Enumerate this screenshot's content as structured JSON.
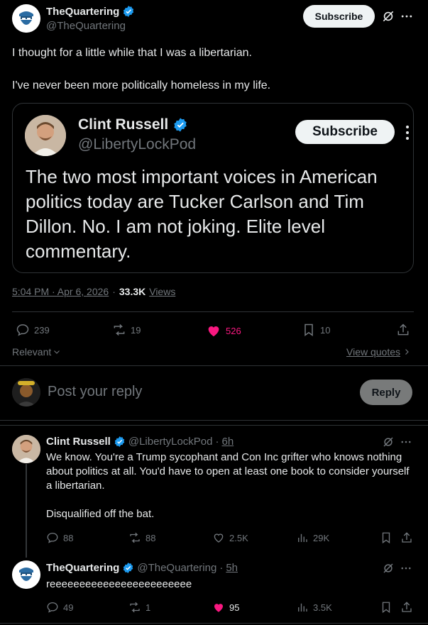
{
  "main_tweet": {
    "author_name": "TheQuartering",
    "author_handle": "@TheQuartering",
    "subscribe_label": "Subscribe",
    "text_line1": "I thought for a little while that I was a libertarian.",
    "text_line2": "I've never been more politically homeless in my life.",
    "timestamp": "5:04 PM · Apr 6, 2026",
    "views_count": "33.3K",
    "views_label": "Views",
    "stats": {
      "replies": "239",
      "retweets": "19",
      "likes": "526",
      "bookmarks": "10"
    }
  },
  "quoted_tweet": {
    "author_name": "Clint Russell",
    "author_handle": "@LibertyLockPod",
    "subscribe_label": "Subscribe",
    "text": "The two most important voices in American politics today are Tucker Carlson and Tim Dillon. No. I am not joking. Elite level commentary."
  },
  "sort": {
    "relevant_label": "Relevant",
    "view_quotes_label": "View quotes"
  },
  "composer": {
    "placeholder": "Post your reply",
    "reply_button_label": "Reply"
  },
  "replies": [
    {
      "author_name": "Clint Russell",
      "author_handle": "@LibertyLockPod",
      "time": "6h",
      "text_p1": "We know. You're a Trump sycophant and Con Inc grifter who knows nothing about politics at all. You'd have to open at least one book to consider yourself a libertarian.",
      "text_p2": "Disqualified off the bat.",
      "stats": {
        "replies": "88",
        "retweets": "88",
        "likes": "2.5K",
        "views": "29K"
      }
    },
    {
      "author_name": "TheQuartering",
      "author_handle": "@TheQuartering",
      "time": "5h",
      "text_p1": "reeeeeeeeeeeeeeeeeeeeeeee",
      "stats": {
        "replies": "49",
        "retweets": "1",
        "likes": "95",
        "views": "3.5K"
      }
    }
  ],
  "colors": {
    "like_pink": "#f91880",
    "verified_blue": "#1d9bf0",
    "muted": "#71767b",
    "border": "#2f3336"
  }
}
